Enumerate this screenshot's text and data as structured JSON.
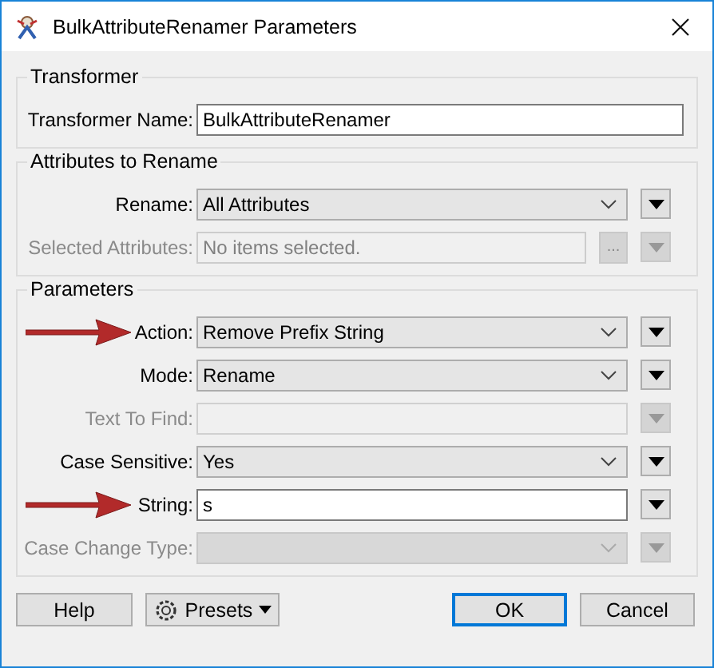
{
  "window": {
    "title": "BulkAttributeRenamer Parameters"
  },
  "groups": [
    {
      "title": "Transformer",
      "rows": [
        {
          "kind": "text",
          "label": "Transformer Name:",
          "value": "BulkAttributeRenamer",
          "disabled": false,
          "pointer": false,
          "menu": false
        }
      ]
    },
    {
      "title": "Attributes to Rename",
      "rows": [
        {
          "kind": "combo",
          "label": "Rename:",
          "value": "All Attributes",
          "disabled": false,
          "pointer": false,
          "menu": true
        },
        {
          "kind": "list",
          "label": "Selected Attributes:",
          "placeholder": "No items selected.",
          "browse": "...",
          "disabled": true,
          "pointer": false,
          "menu": true
        }
      ]
    },
    {
      "title": "Parameters",
      "rows": [
        {
          "kind": "combo",
          "label": "Action:",
          "value": "Remove Prefix String",
          "disabled": false,
          "pointer": true,
          "menu": true
        },
        {
          "kind": "combo",
          "label": "Mode:",
          "value": "Rename",
          "disabled": false,
          "pointer": false,
          "menu": true
        },
        {
          "kind": "text",
          "label": "Text To Find:",
          "disabled": true,
          "pointer": false,
          "menu": true
        },
        {
          "kind": "combo",
          "label": "Case Sensitive:",
          "value": "Yes",
          "disabled": false,
          "pointer": false,
          "menu": true
        },
        {
          "kind": "text",
          "label": "String:",
          "value": "s",
          "disabled": false,
          "pointer": true,
          "menu": true
        },
        {
          "kind": "combo",
          "label": "Case Change Type:",
          "disabled": true,
          "pointer": false,
          "menu": true
        }
      ]
    }
  ],
  "buttons": [
    {
      "kind": "help",
      "label": "Help"
    },
    {
      "kind": "presets",
      "label": "Presets"
    },
    {
      "kind": "ok",
      "label": "OK"
    },
    {
      "kind": "cancel",
      "label": "Cancel"
    }
  ]
}
